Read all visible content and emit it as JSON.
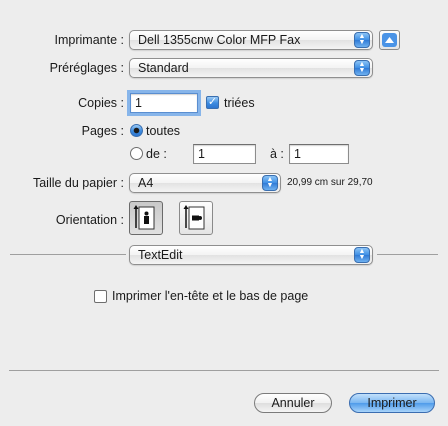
{
  "printer": {
    "label": "Imprimante :",
    "value": "Dell 1355cnw Color MFP Fax"
  },
  "presets": {
    "label": "Préréglages :",
    "value": "Standard"
  },
  "copies": {
    "label": "Copies :",
    "value": "1",
    "collated_label": "triées",
    "collated": true
  },
  "pages": {
    "label": "Pages :",
    "all_label": "toutes",
    "from_label": "de :",
    "from_value": "1",
    "to_label": "à :",
    "to_value": "1",
    "selected": "all"
  },
  "paper": {
    "label": "Taille du papier :",
    "value": "A4",
    "dimensions": "20,99 cm sur 29,70"
  },
  "orientation": {
    "label": "Orientation :",
    "selected": "portrait"
  },
  "section_popup": {
    "value": "TextEdit"
  },
  "header_footer": {
    "label": "Imprimer l'en-tête et le bas de page",
    "checked": false
  },
  "buttons": {
    "cancel": "Annuler",
    "print": "Imprimer"
  },
  "colors": {
    "accent": "#3c8be0",
    "background": "#ededed"
  }
}
